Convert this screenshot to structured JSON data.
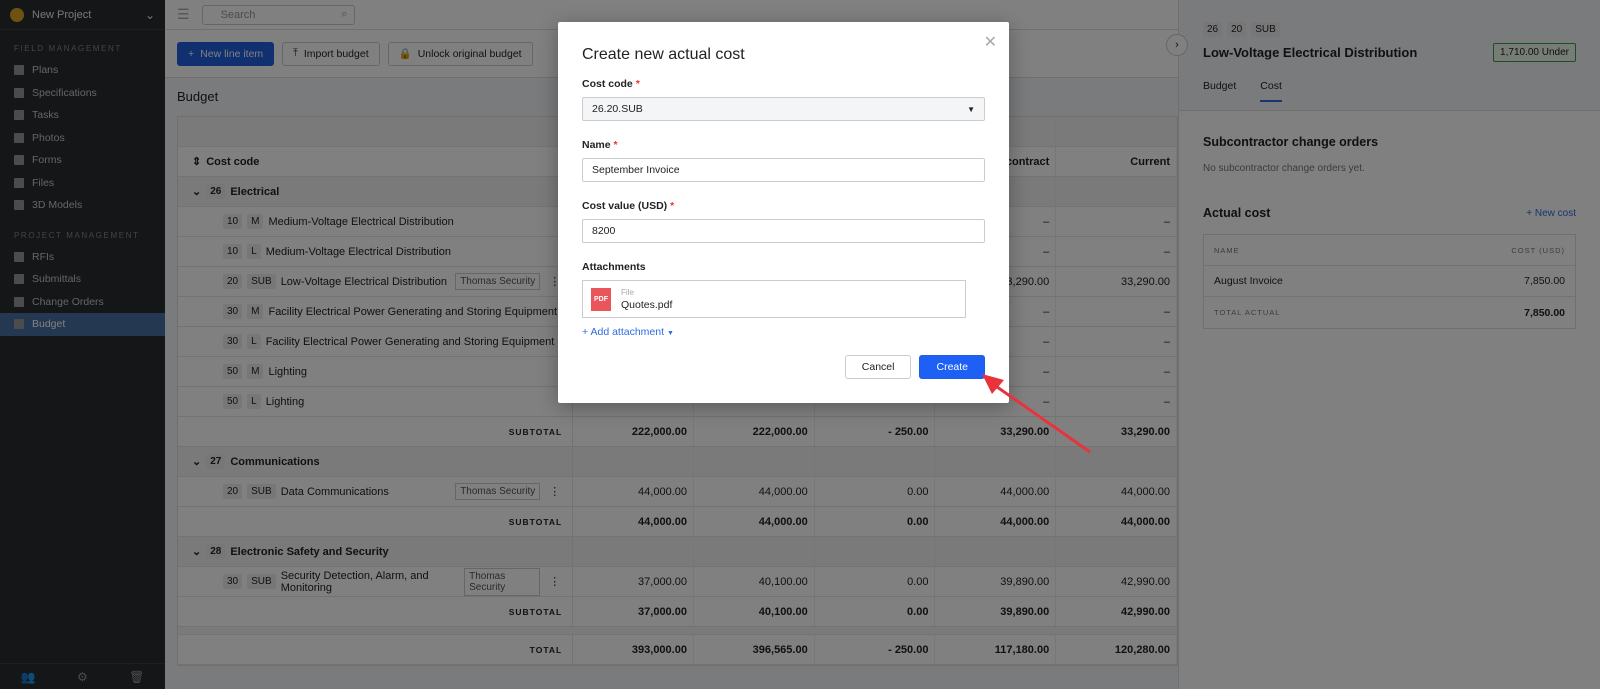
{
  "sidebar": {
    "project": "New Project",
    "sections": [
      {
        "title": "FIELD MANAGEMENT",
        "items": [
          "Plans",
          "Specifications",
          "Tasks",
          "Photos",
          "Forms",
          "Files",
          "3D Models"
        ]
      },
      {
        "title": "PROJECT MANAGEMENT",
        "items": [
          "RFIs",
          "Submittals",
          "Change Orders",
          "Budget"
        ]
      }
    ],
    "active": "Budget"
  },
  "topbar": {
    "search_placeholder": "Search"
  },
  "toolbar": {
    "new_line_item": "New line item",
    "import_budget": "Import budget",
    "unlock_budget": "Unlock original budget"
  },
  "budget": {
    "title": "Budget",
    "col_cost_code": "Cost code",
    "col4": "al contract",
    "col5": "Current",
    "groups": [
      {
        "code": "26",
        "name": "Electrical",
        "items": [
          {
            "code": "10",
            "type": "M",
            "name": "Medium-Voltage Electrical Distribution",
            "vendor": "",
            "v": [
              "",
              "",
              "",
              "–",
              "–"
            ]
          },
          {
            "code": "10",
            "type": "L",
            "name": "Medium-Voltage Electrical Distribution",
            "vendor": "",
            "v": [
              "",
              "",
              "",
              "–",
              "–"
            ]
          },
          {
            "code": "20",
            "type": "SUB",
            "name": "Low-Voltage Electrical Distribution",
            "vendor": "Thomas Security",
            "v": [
              "",
              "",
              "",
              "33,290.00",
              "33,290.00"
            ]
          },
          {
            "code": "30",
            "type": "M",
            "name": "Facility Electrical Power Generating and Storing Equipment",
            "vendor": "",
            "v": [
              "",
              "",
              "",
              "–",
              "–"
            ]
          },
          {
            "code": "30",
            "type": "L",
            "name": "Facility Electrical Power Generating and Storing Equipment",
            "vendor": "",
            "v": [
              "",
              "",
              "",
              "–",
              "–"
            ]
          },
          {
            "code": "50",
            "type": "M",
            "name": "Lighting",
            "vendor": "",
            "v": [
              "",
              "",
              "",
              "–",
              "–"
            ]
          },
          {
            "code": "50",
            "type": "L",
            "name": "Lighting",
            "vendor": "",
            "v": [
              "",
              "",
              "",
              "–",
              "–"
            ]
          }
        ],
        "subtotal_label": "SUBTOTAL",
        "subtotal": [
          "222,000.00",
          "222,000.00",
          "- 250.00",
          "33,290.00",
          "33,290.00"
        ]
      },
      {
        "code": "27",
        "name": "Communications",
        "items": [
          {
            "code": "20",
            "type": "SUB",
            "name": "Data Communications",
            "vendor": "Thomas Security",
            "v": [
              "44,000.00",
              "44,000.00",
              "0.00",
              "44,000.00",
              "44,000.00"
            ]
          }
        ],
        "subtotal_label": "SUBTOTAL",
        "subtotal": [
          "44,000.00",
          "44,000.00",
          "0.00",
          "44,000.00",
          "44,000.00"
        ]
      },
      {
        "code": "28",
        "name": "Electronic Safety and Security",
        "items": [
          {
            "code": "30",
            "type": "SUB",
            "name": "Security Detection, Alarm, and Monitoring",
            "vendor": "Thomas Security",
            "v": [
              "37,000.00",
              "40,100.00",
              "0.00",
              "39,890.00",
              "42,990.00"
            ]
          }
        ],
        "subtotal_label": "SUBTOTAL",
        "subtotal": [
          "37,000.00",
          "40,100.00",
          "0.00",
          "39,890.00",
          "42,990.00"
        ]
      }
    ],
    "total_label": "TOTAL",
    "total": [
      "393,000.00",
      "396,565.00",
      "- 250.00",
      "117,180.00",
      "120,280.00"
    ]
  },
  "panel": {
    "tags": [
      "26",
      "20",
      "SUB"
    ],
    "title": "Low-Voltage Electrical Distribution",
    "status": "1,710.00 Under",
    "tabs": [
      "Budget",
      "Cost"
    ],
    "active_tab": "Cost",
    "sco_title": "Subcontractor change orders",
    "sco_empty": "No subcontractor change orders yet.",
    "actual_title": "Actual cost",
    "new_cost": "+ New cost",
    "col_name": "NAME",
    "col_cost": "COST (USD)",
    "rows": [
      {
        "name": "August Invoice",
        "cost": "7,850.00"
      }
    ],
    "total_label": "TOTAL ACTUAL",
    "total": "7,850.00"
  },
  "modal": {
    "title": "Create new actual cost",
    "cost_code_label": "Cost code",
    "cost_code": "26.20.SUB",
    "name_label": "Name",
    "name": "September Invoice",
    "value_label": "Cost value (USD)",
    "value": "8200",
    "attachments_label": "Attachments",
    "file_label": "File",
    "file_name": "Quotes.pdf",
    "file_type": "PDF",
    "add_attachment": "+ Add attachment",
    "cancel": "Cancel",
    "create": "Create"
  },
  "colors": {
    "accent": "#1e5ff5",
    "annotation": "#e8333d"
  }
}
